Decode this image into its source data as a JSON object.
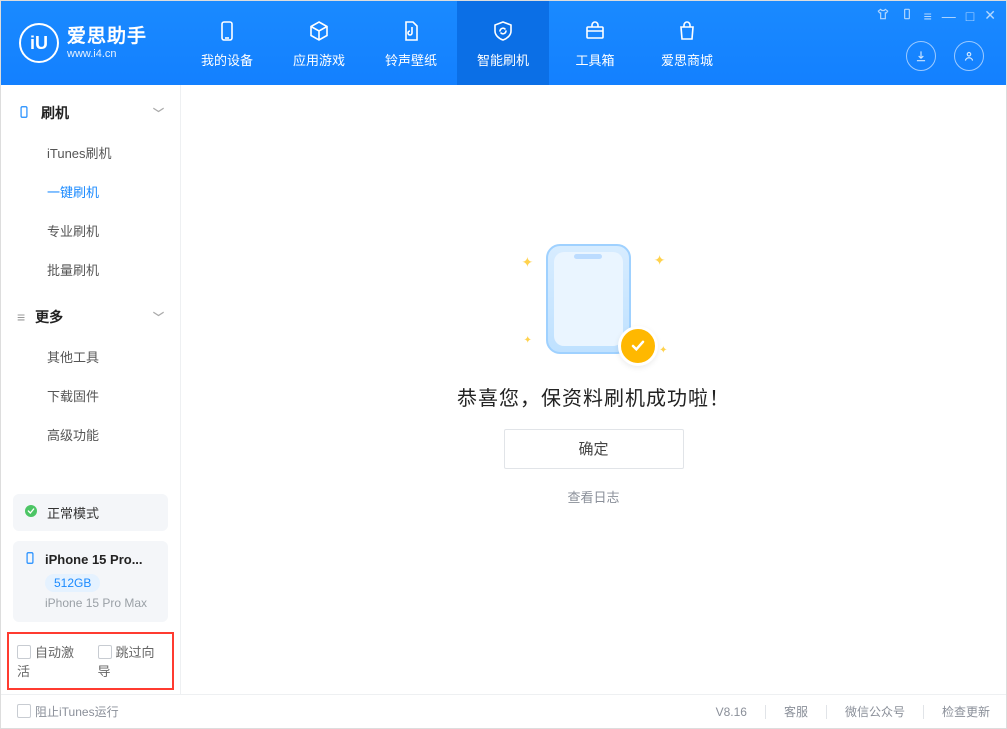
{
  "brand": {
    "title": "爱思助手",
    "subtitle": "www.i4.cn"
  },
  "nav": {
    "items": [
      {
        "label": "我的设备"
      },
      {
        "label": "应用游戏"
      },
      {
        "label": "铃声壁纸"
      },
      {
        "label": "智能刷机",
        "active": true
      },
      {
        "label": "工具箱"
      },
      {
        "label": "爱思商城"
      }
    ]
  },
  "sidebar": {
    "section1": {
      "title": "刷机",
      "items": [
        {
          "label": "iTunes刷机"
        },
        {
          "label": "一键刷机",
          "active": true
        },
        {
          "label": "专业刷机"
        },
        {
          "label": "批量刷机"
        }
      ]
    },
    "section2": {
      "title": "更多",
      "items": [
        {
          "label": "其他工具"
        },
        {
          "label": "下载固件"
        },
        {
          "label": "高级功能"
        }
      ]
    },
    "status_label": "正常模式",
    "device": {
      "name": "iPhone 15 Pro...",
      "storage": "512GB",
      "model": "iPhone 15 Pro Max"
    },
    "opts": {
      "auto_activate": "自动激活",
      "skip_guide": "跳过向导"
    }
  },
  "main": {
    "headline": "恭喜您，保资料刷机成功啦！",
    "ok": "确定",
    "view_log": "查看日志"
  },
  "footer": {
    "block_itunes": "阻止iTunes运行",
    "version": "V8.16",
    "support": "客服",
    "wechat": "微信公众号",
    "check_update": "检查更新"
  }
}
